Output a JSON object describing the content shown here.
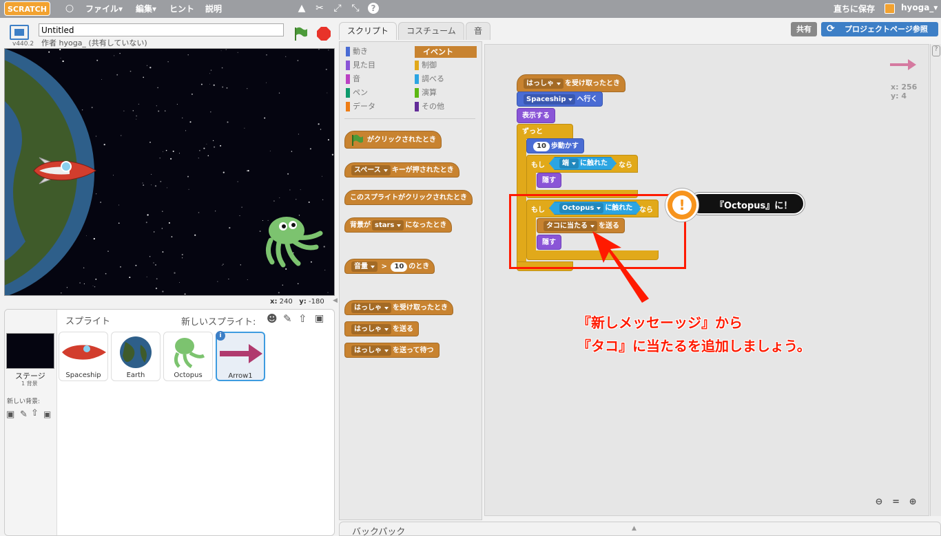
{
  "menubar": {
    "logo": "SCRATCH",
    "file": "ファイル▾",
    "edit": "編集▾",
    "hint": "ヒント",
    "about": "説明",
    "save_now": "直ちに保存",
    "user": "hyoga_▾"
  },
  "stage_header": {
    "version": "v440.2",
    "project_title": "Untitled",
    "author": "作者 hyoga_ (共有していない)"
  },
  "stage_coords": {
    "x_label": "x:",
    "x_value": "240",
    "y_label": "y:",
    "y_value": "-180"
  },
  "sprites_panel": {
    "title": "スプライト",
    "new_sprite": "新しいスプライト:",
    "stage_label": "ステージ",
    "stage_sub": "1 背景",
    "new_backdrop": "新しい背景:",
    "sprites": [
      "Spaceship",
      "Earth",
      "Octopus",
      "Arrow1"
    ]
  },
  "tabs": [
    "スクリプト",
    "コスチューム",
    "音"
  ],
  "top_right": {
    "share": "共有",
    "project_page": "プロジェクトページ参照"
  },
  "categories_left": [
    "動き",
    "見た目",
    "音",
    "ペン",
    "データ"
  ],
  "categories_right": [
    "イベント",
    "制御",
    "調べる",
    "演算",
    "その他"
  ],
  "palette_blocks": {
    "flag_clicked": "がクリックされたとき",
    "key_pressed": {
      "key": "スペース",
      "text": "キーが押されたとき"
    },
    "sprite_clicked": "このスプライトがクリックされたとき",
    "backdrop_switch": {
      "prefix": "背景が",
      "value": "stars",
      "text": "になったとき"
    },
    "loudness": {
      "label": "音量",
      "op": ">",
      "value": "10",
      "text": "のとき"
    },
    "receive": {
      "msg": "はっしゃ",
      "text": "を受け取ったとき"
    },
    "broadcast": {
      "msg": "はっしゃ",
      "text": "を送る"
    },
    "broadcast_wait": {
      "msg": "はっしゃ",
      "text": "を送って待つ"
    }
  },
  "script_blocks": {
    "hat": {
      "msg": "はっしゃ",
      "text": "を受け取ったとき"
    },
    "goto": {
      "target": "Spaceship",
      "text": "へ行く"
    },
    "show": "表示する",
    "forever": "ずっと",
    "move": {
      "steps": "10",
      "text": "歩動かす"
    },
    "if1": {
      "if": "もし",
      "target": "端",
      "touch": "に触れた",
      "then": "なら"
    },
    "hide1": "隠す",
    "if2": {
      "if": "もし",
      "target": "Octopus",
      "touch": "に触れた",
      "then": "なら"
    },
    "broadcast": {
      "msg": "タコに当たる",
      "text": "を送る"
    },
    "hide2": "隠す"
  },
  "sprite_info": {
    "x_label": "x:",
    "x_value": "256",
    "y_label": "y:",
    "y_value": "4"
  },
  "callout": {
    "icon": "!",
    "text": "『Octopus』に！"
  },
  "annotation": {
    "line1": "『新しメッセーッジ』から",
    "line2": "『タコ』に当たるを追加しましょう。"
  },
  "backpack": "バックパック",
  "colors": {
    "annotation_red": "#ff1a00",
    "callout_orange": "#f7941d",
    "arrow_sprite": "#b03a6e"
  }
}
